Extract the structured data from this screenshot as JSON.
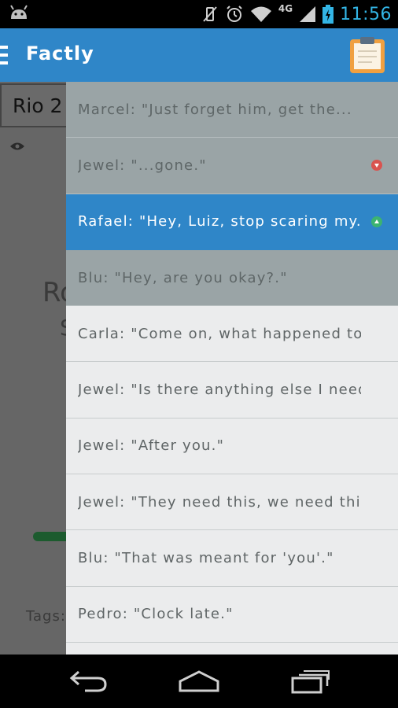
{
  "status_bar": {
    "network": "4G",
    "time": "11:56"
  },
  "action_bar": {
    "title": "Factly"
  },
  "background": {
    "movie_tab": "Rio 2",
    "partial_big": "Ro",
    "partial_small": "S",
    "tags_label": "Tags:"
  },
  "drawer": {
    "items": [
      {
        "text": "Marcel: \"Just forget him, get the...",
        "state": "dim",
        "vote": ""
      },
      {
        "text": "Jewel: \"...gone.\"",
        "state": "dim",
        "vote": "down"
      },
      {
        "text": "Rafael: \"Hey, Luiz, stop scaring my...",
        "state": "selected",
        "vote": "up"
      },
      {
        "text": "Blu: \"Hey, are you okay?.\"",
        "state": "dim",
        "vote": ""
      },
      {
        "text": "Carla: \"Come on, what happened to...",
        "state": "normal",
        "vote": ""
      },
      {
        "text": "Jewel: \"Is there anything else I need...",
        "state": "normal",
        "vote": ""
      },
      {
        "text": "Jewel: \"After you.\"",
        "state": "normal",
        "vote": ""
      },
      {
        "text": "Jewel: \"They need this, we need thi...",
        "state": "normal",
        "vote": ""
      },
      {
        "text": "Blu: \"That was meant for 'you'.\"",
        "state": "normal",
        "vote": ""
      },
      {
        "text": "Pedro: \"Clock late.\"",
        "state": "normal",
        "vote": ""
      }
    ]
  },
  "colors": {
    "accent": "#2f86c8",
    "clock": "#33b5e5",
    "downvote": "#d9534f",
    "upvote": "#3cb371"
  }
}
